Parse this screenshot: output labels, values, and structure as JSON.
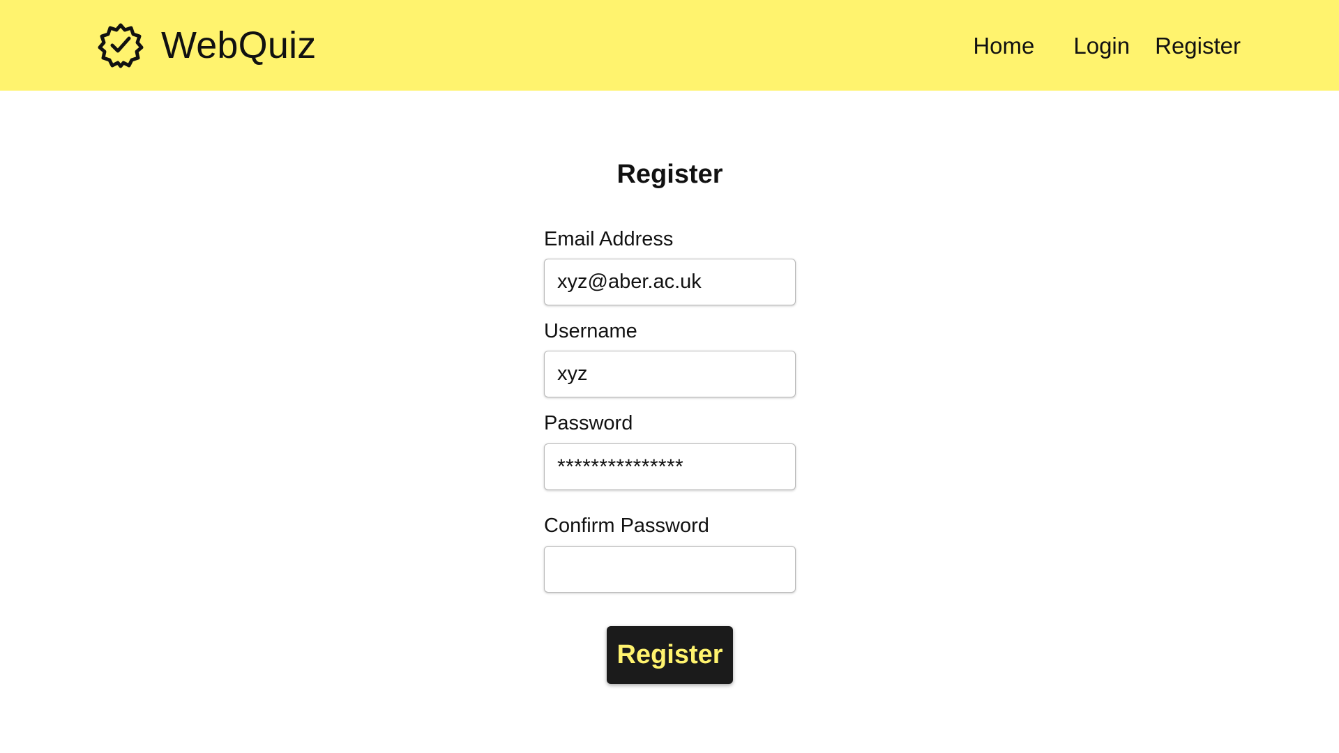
{
  "app": {
    "name": "WebQuiz",
    "logo_icon": "badge-check-icon"
  },
  "nav": {
    "home": "Home",
    "login": "Login",
    "register": "Register"
  },
  "form": {
    "title": "Register",
    "email": {
      "label": "Email Address",
      "value": "xyz@aber.ac.uk"
    },
    "username": {
      "label": "Username",
      "value": "xyz"
    },
    "password": {
      "label": "Password",
      "value": "***************"
    },
    "confirm_password": {
      "label": "Confirm Password",
      "value": ""
    },
    "submit_label": "Register"
  },
  "colors": {
    "header_background": "#fff36e",
    "button_background": "#1b1b1b",
    "button_text": "#fff36e",
    "text": "#111111"
  }
}
